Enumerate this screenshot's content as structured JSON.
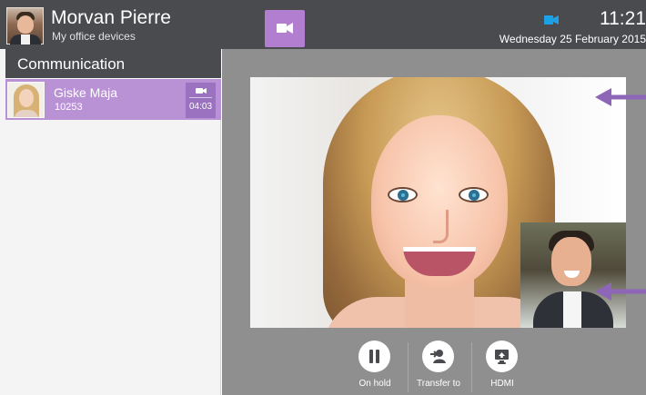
{
  "header": {
    "user_name": "Morvan Pierre",
    "status": "My office devices",
    "time": "11:21",
    "date": "Wednesday 25 February 2015",
    "accent_color": "#b27fd0",
    "video_status_color": "#1aa1e6",
    "icons": {
      "avatar": "user-photo",
      "video_button": "video-camera-icon",
      "video_status": "video-camera-icon"
    }
  },
  "sidebar": {
    "title": "Communication",
    "calls": [
      {
        "name": "Giske Maja",
        "number": "10253",
        "duration": "04:03",
        "type": "video",
        "selected": true,
        "icon": "video-camera-icon"
      }
    ]
  },
  "video": {
    "remote_feed": "remote-participant-video",
    "self_feed": "self-preview-video",
    "pointer_color": "#8e66b8"
  },
  "controls": [
    {
      "label": "On hold",
      "icon": "pause-icon"
    },
    {
      "label": "Transfer to",
      "icon": "transfer-user-icon"
    },
    {
      "label": "HDMI",
      "icon": "hdmi-screen-icon"
    }
  ],
  "colors": {
    "header_bg": "#4a4b4f",
    "selected_call_bg": "#b892d4",
    "stage_bg": "#8f8f8f"
  }
}
